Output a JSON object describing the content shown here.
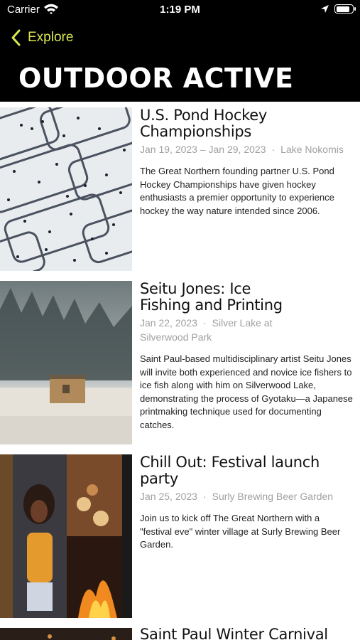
{
  "status_bar": {
    "carrier": "Carrier",
    "time": "1:19 PM",
    "battery_level": 0.9
  },
  "nav": {
    "back_label": "Explore",
    "accent_color": "#d9e64d"
  },
  "page": {
    "title": "OUTDOOR ACTIVE"
  },
  "events": [
    {
      "title": "U.S. Pond Hockey Championships",
      "date": "Jan 19, 2023 – Jan 29, 2023",
      "location": "Lake Nokomis",
      "description": "The Great Northern founding partner U.S. Pond Hockey Championships have given hockey enthusiasts a premier opportunity to experience hockey the way nature intended since 2006.",
      "image": "pond-hockey-aerial"
    },
    {
      "title": "Seitu Jones: Ice Fishing and Printing",
      "date": "Jan 22, 2023",
      "location": "Silver Lake at Silverwood Park",
      "description": "Saint Paul-based multidisciplinary artist Seitu Jones will invite both experienced and novice ice fishers to ice fish along with him on Silverwood Lake, demonstrating the process of Gyotaku—a Japanese printmaking technique used for documenting catches.",
      "image": "ice-fishing-house"
    },
    {
      "title": "Chill Out: Festival launch party",
      "date": "Jan 25, 2023",
      "location": "Surly Brewing Beer Garden",
      "description": "Join us to kick off The Great Northern with a \"festival eve\" winter village at Surly Brewing Beer Garden.",
      "image": "festival-collage"
    },
    {
      "title": "Saint Paul Winter Carnival",
      "image": "winter-carnival"
    }
  ]
}
